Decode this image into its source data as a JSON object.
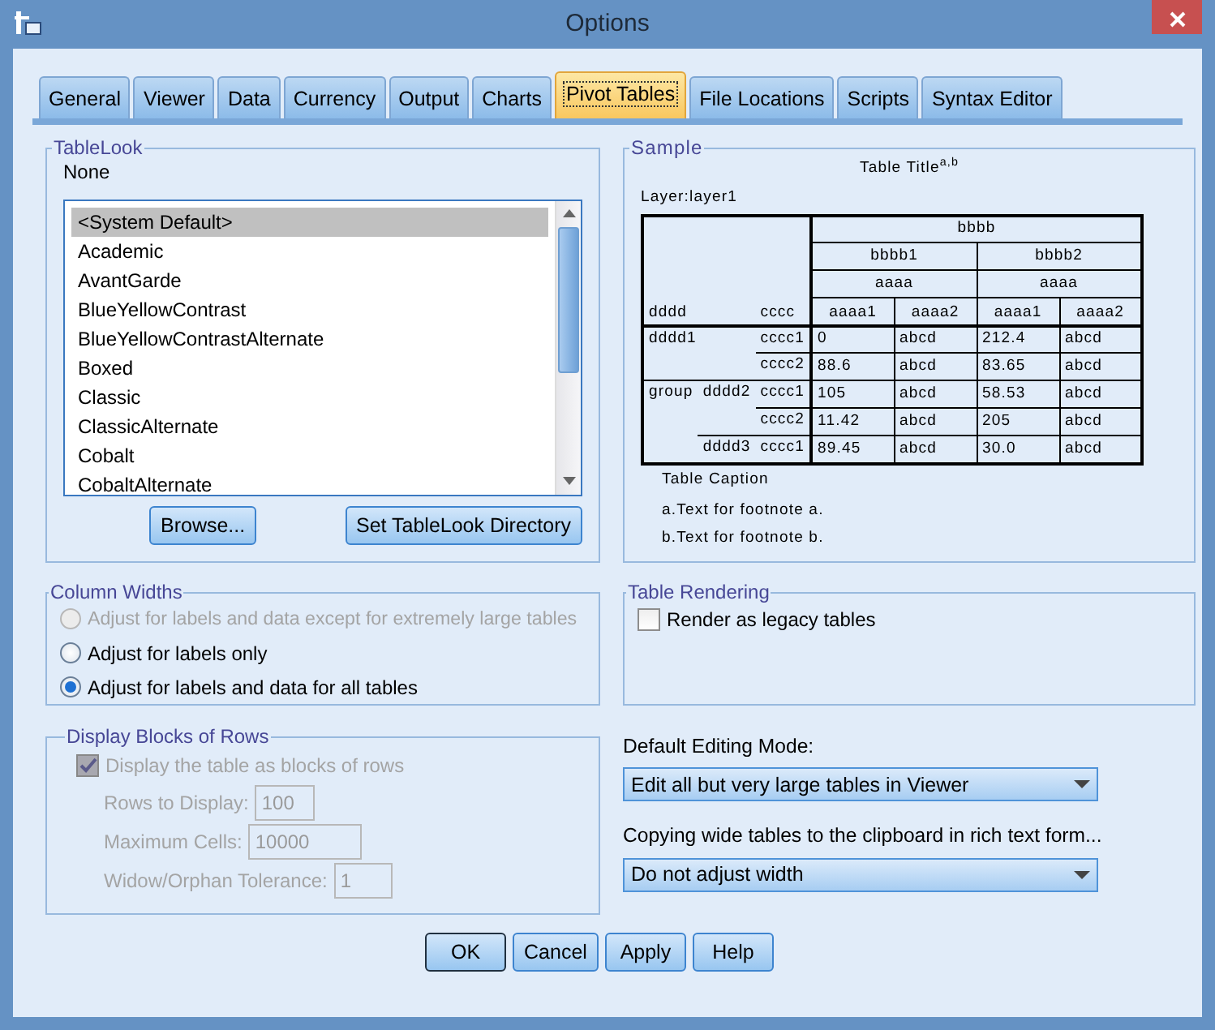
{
  "window": {
    "title": "Options"
  },
  "tabs": [
    {
      "label": "General",
      "selected": false
    },
    {
      "label": "Viewer",
      "selected": false
    },
    {
      "label": "Data",
      "selected": false
    },
    {
      "label": "Currency",
      "selected": false
    },
    {
      "label": "Output",
      "selected": false
    },
    {
      "label": "Charts",
      "selected": false
    },
    {
      "label": "Pivot Tables",
      "selected": true
    },
    {
      "label": "File Locations",
      "selected": false
    },
    {
      "label": "Scripts",
      "selected": false
    },
    {
      "label": "Syntax Editor",
      "selected": false
    }
  ],
  "tablelook": {
    "title": "TableLook",
    "current": "None",
    "items": [
      {
        "label": "<System Default>",
        "selected": true
      },
      {
        "label": "Academic",
        "selected": false
      },
      {
        "label": "AvantGarde",
        "selected": false
      },
      {
        "label": "BlueYellowContrast",
        "selected": false
      },
      {
        "label": "BlueYellowContrastAlternate",
        "selected": false
      },
      {
        "label": "Boxed",
        "selected": false
      },
      {
        "label": "Classic",
        "selected": false
      },
      {
        "label": "ClassicAlternate",
        "selected": false
      },
      {
        "label": "Cobalt",
        "selected": false
      },
      {
        "label": "CobaltAlternate",
        "selected": false
      }
    ],
    "buttons": [
      "Browse...",
      "Set TableLook Directory"
    ]
  },
  "sample": {
    "title": "Sample",
    "table_title": "Table Title$^{a,b}$",
    "layer": "Layer:layer1",
    "top_header": "bbbb",
    "groups": [
      {
        "label": "bbbb1",
        "sub": "aaaa",
        "leaves": [
          "aaaa1",
          "aaaa2"
        ]
      },
      {
        "label": "bbbb2",
        "sub": "aaaa",
        "leaves": [
          "aaaa1",
          "aaaa2"
        ]
      }
    ],
    "corner": [
      "dddd",
      "cccc"
    ],
    "row_groups": [
      {
        "kind": "single",
        "label": "dddd1",
        "rows": [
          {
            "stub": "cccc1",
            "cells": [
              "0",
              "abcd",
              "212.4",
              "abcd"
            ]
          },
          {
            "stub": "cccc2",
            "cells": [
              "88.6",
              "abcd",
              "83.65",
              "abcd"
            ]
          }
        ]
      },
      {
        "kind": "nested",
        "label": "group",
        "children": [
          {
            "label": "dddd2",
            "rows": [
              {
                "stub": "cccc1",
                "cells": [
                  "105",
                  "abcd",
                  "58.53",
                  "abcd"
                ]
              },
              {
                "stub": "cccc2",
                "cells": [
                  "11.42",
                  "abcd",
                  "205",
                  "abcd"
                ]
              }
            ]
          },
          {
            "label": "dddd3",
            "rows": [
              {
                "stub": "cccc1",
                "cells": [
                  "89.45",
                  "abcd",
                  "30.0",
                  "abcd"
                ]
              }
            ]
          }
        ]
      }
    ],
    "caption": "Table Caption",
    "footnotes": [
      "a.Text for footnote a.",
      "b.Text for footnote b."
    ]
  },
  "column_widths": {
    "title": "Column Widths",
    "options": [
      {
        "label": "Adjust for labels and data except for extremely large tables",
        "selected": false,
        "disabled": true
      },
      {
        "label": "Adjust for labels only",
        "selected": false,
        "disabled": false
      },
      {
        "label": "Adjust for labels and data for all tables",
        "selected": true,
        "disabled": false
      }
    ]
  },
  "table_rendering": {
    "title": "Table Rendering",
    "checkbox": {
      "label": "Render as legacy tables",
      "checked": false
    }
  },
  "display_blocks": {
    "title": "Display Blocks of Rows",
    "checkbox": {
      "label": "Display the table as blocks of rows",
      "checked": true,
      "disabled": true
    },
    "fields": [
      {
        "label": "Rows to Display:",
        "value": "100",
        "disabled": true
      },
      {
        "label": "Maximum Cells:",
        "value": "10000",
        "disabled": true
      },
      {
        "label": "Widow/Orphan Tolerance:",
        "value": "1",
        "disabled": true
      }
    ]
  },
  "editing_mode": {
    "label": "Default Editing Mode:",
    "value": "Edit all but very large tables in Viewer"
  },
  "copying": {
    "label": "Copying wide tables to the clipboard in rich text form...",
    "value": "Do not adjust width"
  },
  "buttons": [
    {
      "label": "OK",
      "default": true
    },
    {
      "label": "Cancel",
      "default": false
    },
    {
      "label": "Apply",
      "default": false
    },
    {
      "label": "Help",
      "default": false
    }
  ]
}
